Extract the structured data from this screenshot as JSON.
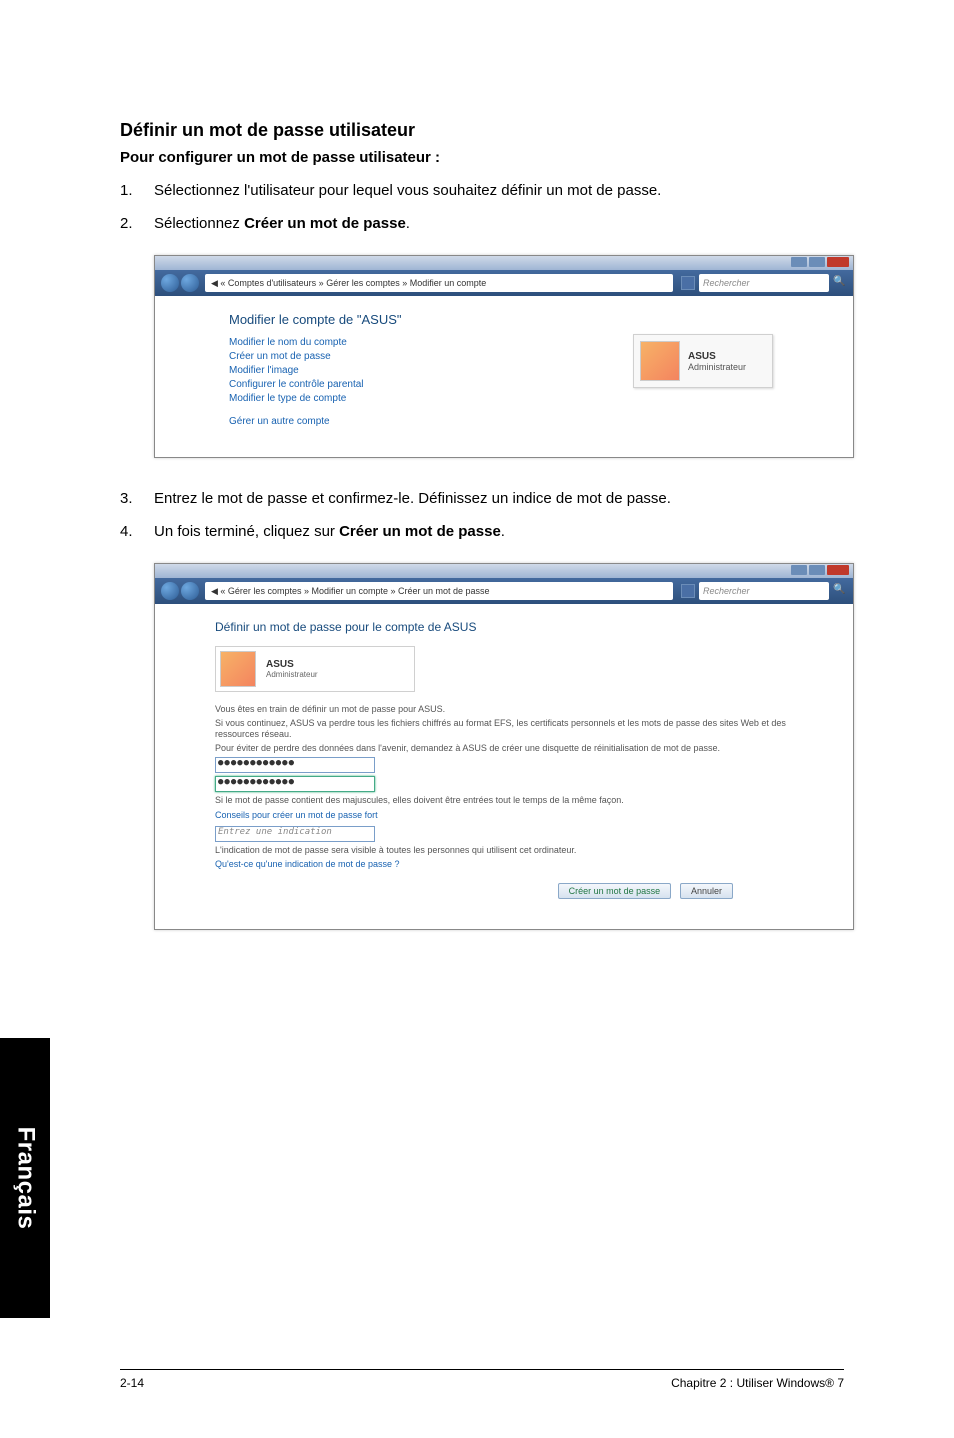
{
  "section": {
    "title": "Définir un mot de passe utilisateur",
    "subtitle": "Pour configurer un mot de passe utilisateur :"
  },
  "steps_a": [
    {
      "num": "1.",
      "text": "Sélectionnez l'utilisateur pour lequel vous souhaitez définir un mot de passe."
    },
    {
      "num": "2.",
      "text_prefix": "Sélectionnez ",
      "text_bold": "Créer un mot de passe",
      "text_suffix": "."
    }
  ],
  "ss1": {
    "breadcrumb": "◀ « Comptes d'utilisateurs » Gérer les comptes » Modifier un compte",
    "search_placeholder": "Rechercher",
    "heading": "Modifier le compte de \"ASUS\"",
    "links": [
      "Modifier le nom du compte",
      "Créer un mot de passe",
      "Modifier l'image",
      "Configurer le contrôle parental",
      "Modifier le type de compte"
    ],
    "link_supprimer": "Gérer un autre compte",
    "account": {
      "name": "ASUS",
      "role": "Administrateur"
    }
  },
  "steps_b": [
    {
      "num": "3.",
      "text": "Entrez le mot de passe et confirmez-le. Définissez un indice de mot de passe."
    },
    {
      "num": "4.",
      "text_prefix": "Un fois terminé, cliquez sur ",
      "text_bold": "Créer un mot de passe",
      "text_suffix": "."
    }
  ],
  "ss2": {
    "breadcrumb": "◀ « Gérer les comptes » Modifier un compte » Créer un mot de passe",
    "search_placeholder": "Rechercher",
    "heading": "Définir un mot de passe pour le compte de ASUS",
    "account": {
      "name": "ASUS",
      "role": "Administrateur"
    },
    "p_intro": "Vous êtes en train de définir un mot de passe pour ASUS.",
    "p_warn": "Si vous continuez, ASUS va perdre tous les fichiers chiffrés au format EFS, les certificats personnels et les mots de passe des sites Web et des ressources réseau.",
    "p_hint": "Pour éviter de perdre des données dans l'avenir, demandez à ASUS de créer une disquette de réinitialisation de mot de passe.",
    "pw1": "●●●●●●●●●●●●",
    "pw2": "●●●●●●●●●●●●",
    "p_hint2": "Si le mot de passe contient des majuscules, elles doivent être entrées tout le temps de la même façon.",
    "link_help1": "Conseils pour créer un mot de passe fort",
    "hint_label": "Entrez une indication",
    "p_visible": "L'indication de mot de passe sera visible à toutes les personnes qui utilisent cet ordinateur.",
    "link_help2": "Qu'est-ce qu'une indication de mot de passe ?",
    "btn_create": "Créer un mot de passe",
    "btn_cancel": "Annuler"
  },
  "side_tab": "Français",
  "footer": {
    "left": "2-14",
    "right": "Chapitre 2 : Utiliser Windows® 7"
  }
}
